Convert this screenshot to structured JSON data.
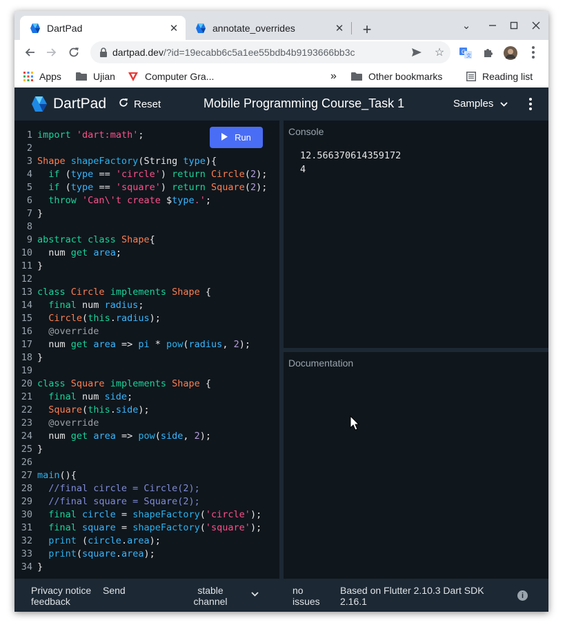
{
  "browser": {
    "tabs": [
      {
        "title": "DartPad",
        "active": true
      },
      {
        "title": "annotate_overrides",
        "active": false
      }
    ],
    "new_tab": "+",
    "address": {
      "host": "dartpad.dev",
      "path": "/?id=19ecabb6c5a1ee55bdb4b9193666bb3c"
    },
    "bookmarks": {
      "apps": "Apps",
      "ujian": "Ujian",
      "computer_graphics": "Computer Gra...",
      "overflow": "»",
      "other": "Other bookmarks",
      "reading_list": "Reading list"
    }
  },
  "header": {
    "brand": "DartPad",
    "reset": "Reset",
    "title": "Mobile Programming Course_Task 1",
    "samples": "Samples"
  },
  "editor": {
    "run_label": "Run",
    "lines": [
      [
        [
          "kw",
          "import"
        ],
        [
          "def",
          " "
        ],
        [
          "str",
          "'dart:math'"
        ],
        [
          "def",
          ";"
        ]
      ],
      [],
      [
        [
          "ty",
          "Shape"
        ],
        [
          "def",
          " "
        ],
        [
          "fn",
          "shapeFactory"
        ],
        [
          "def",
          "(String "
        ],
        [
          "id",
          "type"
        ],
        [
          "def",
          "){"
        ]
      ],
      [
        [
          "def",
          "  "
        ],
        [
          "kw",
          "if"
        ],
        [
          "def",
          " ("
        ],
        [
          "id",
          "type"
        ],
        [
          "def",
          " == "
        ],
        [
          "str",
          "'circle'"
        ],
        [
          "def",
          ") "
        ],
        [
          "kw",
          "return"
        ],
        [
          "def",
          " "
        ],
        [
          "ty",
          "Circle"
        ],
        [
          "def",
          "("
        ],
        [
          "num",
          "2"
        ],
        [
          "def",
          ");"
        ]
      ],
      [
        [
          "def",
          "  "
        ],
        [
          "kw",
          "if"
        ],
        [
          "def",
          " ("
        ],
        [
          "id",
          "type"
        ],
        [
          "def",
          " == "
        ],
        [
          "str",
          "'square'"
        ],
        [
          "def",
          ") "
        ],
        [
          "kw",
          "return"
        ],
        [
          "def",
          " "
        ],
        [
          "ty",
          "Square"
        ],
        [
          "def",
          "("
        ],
        [
          "num",
          "2"
        ],
        [
          "def",
          ");"
        ]
      ],
      [
        [
          "def",
          "  "
        ],
        [
          "kw",
          "throw"
        ],
        [
          "def",
          " "
        ],
        [
          "str",
          "'Can\\'t create "
        ],
        [
          "def",
          "$"
        ],
        [
          "id",
          "type"
        ],
        [
          "str",
          ".'"
        ],
        [
          "def",
          ";"
        ]
      ],
      [
        [
          "def",
          "}"
        ]
      ],
      [],
      [
        [
          "kw",
          "abstract"
        ],
        [
          "def",
          " "
        ],
        [
          "kw",
          "class"
        ],
        [
          "def",
          " "
        ],
        [
          "ty",
          "Shape"
        ],
        [
          "def",
          "{"
        ]
      ],
      [
        [
          "def",
          "  num "
        ],
        [
          "kw",
          "get"
        ],
        [
          "def",
          " "
        ],
        [
          "id",
          "area"
        ],
        [
          "def",
          ";"
        ]
      ],
      [
        [
          "def",
          "}"
        ]
      ],
      [],
      [
        [
          "kw",
          "class"
        ],
        [
          "def",
          " "
        ],
        [
          "ty",
          "Circle"
        ],
        [
          "def",
          " "
        ],
        [
          "kw",
          "implements"
        ],
        [
          "def",
          " "
        ],
        [
          "ty",
          "Shape"
        ],
        [
          "def",
          " {"
        ]
      ],
      [
        [
          "def",
          "  "
        ],
        [
          "kw",
          "final"
        ],
        [
          "def",
          " num "
        ],
        [
          "id",
          "radius"
        ],
        [
          "def",
          ";"
        ]
      ],
      [
        [
          "def",
          "  "
        ],
        [
          "ty",
          "Circle"
        ],
        [
          "def",
          "("
        ],
        [
          "kw",
          "this"
        ],
        [
          "def",
          "."
        ],
        [
          "id",
          "radius"
        ],
        [
          "def",
          ");"
        ]
      ],
      [
        [
          "def",
          "  "
        ],
        [
          "an",
          "@override"
        ]
      ],
      [
        [
          "def",
          "  num "
        ],
        [
          "kw",
          "get"
        ],
        [
          "def",
          " "
        ],
        [
          "id",
          "area"
        ],
        [
          "def",
          " => "
        ],
        [
          "id",
          "pi"
        ],
        [
          "def",
          " * "
        ],
        [
          "fn",
          "pow"
        ],
        [
          "def",
          "("
        ],
        [
          "id",
          "radius"
        ],
        [
          "def",
          ", "
        ],
        [
          "num",
          "2"
        ],
        [
          "def",
          ");"
        ]
      ],
      [
        [
          "def",
          "}"
        ]
      ],
      [],
      [
        [
          "kw",
          "class"
        ],
        [
          "def",
          " "
        ],
        [
          "ty",
          "Square"
        ],
        [
          "def",
          " "
        ],
        [
          "kw",
          "implements"
        ],
        [
          "def",
          " "
        ],
        [
          "ty",
          "Shape"
        ],
        [
          "def",
          " {"
        ]
      ],
      [
        [
          "def",
          "  "
        ],
        [
          "kw",
          "final"
        ],
        [
          "def",
          " num "
        ],
        [
          "id",
          "side"
        ],
        [
          "def",
          ";"
        ]
      ],
      [
        [
          "def",
          "  "
        ],
        [
          "ty",
          "Square"
        ],
        [
          "def",
          "("
        ],
        [
          "kw",
          "this"
        ],
        [
          "def",
          "."
        ],
        [
          "id",
          "side"
        ],
        [
          "def",
          ");"
        ]
      ],
      [
        [
          "def",
          "  "
        ],
        [
          "an",
          "@override"
        ]
      ],
      [
        [
          "def",
          "  num "
        ],
        [
          "kw",
          "get"
        ],
        [
          "def",
          " "
        ],
        [
          "id",
          "area"
        ],
        [
          "def",
          " => "
        ],
        [
          "fn",
          "pow"
        ],
        [
          "def",
          "("
        ],
        [
          "id",
          "side"
        ],
        [
          "def",
          ", "
        ],
        [
          "num",
          "2"
        ],
        [
          "def",
          ");"
        ]
      ],
      [
        [
          "def",
          "}"
        ]
      ],
      [],
      [
        [
          "fn",
          "main"
        ],
        [
          "def",
          "(){"
        ]
      ],
      [
        [
          "def",
          "  "
        ],
        [
          "cm",
          "//final circle = Circle(2);"
        ]
      ],
      [
        [
          "def",
          "  "
        ],
        [
          "cm",
          "//final square = Square(2);"
        ]
      ],
      [
        [
          "def",
          "  "
        ],
        [
          "kw",
          "final"
        ],
        [
          "def",
          " "
        ],
        [
          "id",
          "circle"
        ],
        [
          "def",
          " = "
        ],
        [
          "fn",
          "shapeFactory"
        ],
        [
          "def",
          "("
        ],
        [
          "str",
          "'circle'"
        ],
        [
          "def",
          ");"
        ]
      ],
      [
        [
          "def",
          "  "
        ],
        [
          "kw",
          "final"
        ],
        [
          "def",
          " "
        ],
        [
          "id",
          "square"
        ],
        [
          "def",
          " = "
        ],
        [
          "fn",
          "shapeFactory"
        ],
        [
          "def",
          "("
        ],
        [
          "str",
          "'square'"
        ],
        [
          "def",
          ");"
        ]
      ],
      [
        [
          "def",
          "  "
        ],
        [
          "fn",
          "print"
        ],
        [
          "def",
          " ("
        ],
        [
          "id",
          "circle"
        ],
        [
          "def",
          "."
        ],
        [
          "id",
          "area"
        ],
        [
          "def",
          ");"
        ]
      ],
      [
        [
          "def",
          "  "
        ],
        [
          "fn",
          "print"
        ],
        [
          "def",
          "("
        ],
        [
          "id",
          "square"
        ],
        [
          "def",
          "."
        ],
        [
          "id",
          "area"
        ],
        [
          "def",
          ");"
        ]
      ],
      [
        [
          "def",
          "}"
        ]
      ]
    ]
  },
  "console": {
    "label": "Console",
    "output": [
      "12.566370614359172",
      "4"
    ]
  },
  "documentation": {
    "label": "Documentation"
  },
  "footer": {
    "privacy_1": "Privacy notice",
    "privacy_2": "feedback",
    "send": "Send",
    "channel_1": "stable",
    "channel_2": "channel",
    "issues_1": "no",
    "issues_2": "issues",
    "sdk_1": "Based on Flutter 2.10.3 Dart SDK",
    "sdk_2": "2.16.1"
  },
  "colors": {
    "keyword": "#19d49b",
    "type": "#ff7f50",
    "function": "#2bb2ee",
    "string": "#ff4f8b",
    "number": "#b39ddb",
    "identifier": "#38b6ff",
    "comment": "#7f8bd6",
    "run_button": "#4a6df5",
    "header_bg": "#1c2834",
    "panel_bg": "#0f161c"
  },
  "icons": [
    "dart-logo-icon",
    "close-icon",
    "new-tab-icon",
    "back-icon",
    "forward-icon",
    "reload-icon",
    "lock-icon",
    "share-icon",
    "star-icon",
    "translate-icon",
    "extensions-icon",
    "profile-avatar",
    "more-vert-icon",
    "apps-grid-icon",
    "folder-icon",
    "bookmark-triangle-icon",
    "reading-list-icon",
    "play-icon",
    "info-icon",
    "mouse-cursor-icon"
  ]
}
